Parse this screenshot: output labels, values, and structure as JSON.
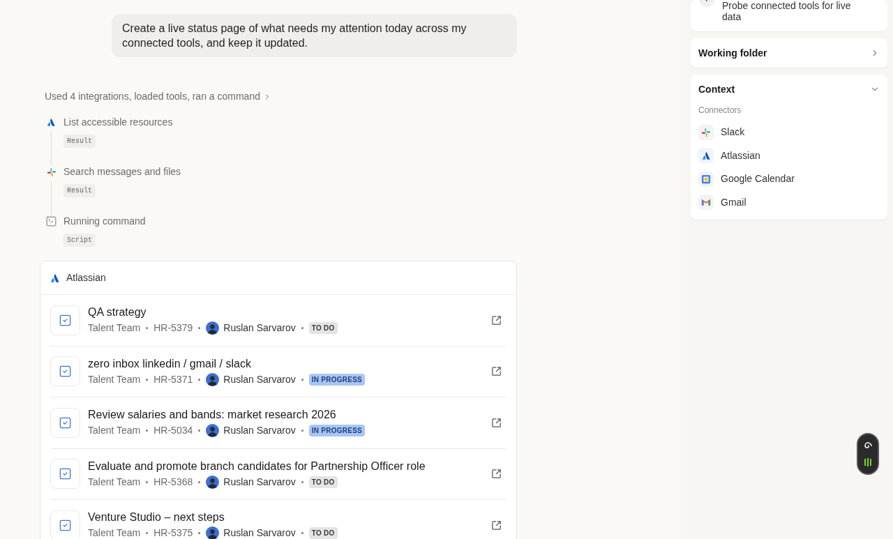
{
  "user_message": "Create a live status page of what needs my attention today across my connected tools, and keep it updated.",
  "activity": {
    "summary": "Used 4 integrations, loaded tools, ran a command",
    "expanded": false,
    "steps": [
      {
        "kind": "atlassian",
        "label": "List accessible resources",
        "tag": "Result"
      },
      {
        "kind": "slack",
        "label": "Search messages and files",
        "tag": "Result"
      },
      {
        "kind": "terminal",
        "label": "Running command",
        "tag": "Script"
      }
    ]
  },
  "card": {
    "title": "Atlassian",
    "issues": [
      {
        "title": "QA strategy",
        "team": "Talent Team",
        "key": "HR-5379",
        "assignee": "Ruslan Sarvarov",
        "status": "TO DO",
        "kind": "todo",
        "checked": true
      },
      {
        "title": "zero inbox linkedin / gmail / slack",
        "team": "Talent Team",
        "key": "HR-5371",
        "assignee": "Ruslan Sarvarov",
        "status": "IN PROGRESS",
        "kind": "progress",
        "checked": true
      },
      {
        "title": "Review salaries and bands: market research 2026",
        "team": "Talent Team",
        "key": "HR-5034",
        "assignee": "Ruslan Sarvarov",
        "status": "IN PROGRESS",
        "kind": "progress",
        "checked": true
      },
      {
        "title": "Evaluate and promote branch candidates for Partnership Officer role",
        "team": "Talent Team",
        "key": "HR-5368",
        "assignee": "Ruslan Sarvarov",
        "status": "TO DO",
        "kind": "todo",
        "checked": true
      },
      {
        "title": "Venture Studio – next steps",
        "team": "Talent Team",
        "key": "HR-5375",
        "assignee": "Ruslan Sarvarov",
        "status": "TO DO",
        "kind": "todo",
        "checked": true
      }
    ]
  },
  "sidebar": {
    "progress_step": "Probe connected tools for live data",
    "working_folder": {
      "title": "Working folder",
      "expanded": false
    },
    "context": {
      "title": "Context",
      "expanded": true,
      "section": "Connectors",
      "connectors": [
        {
          "kind": "slack",
          "name": "Slack"
        },
        {
          "kind": "atlassian",
          "name": "Atlassian"
        },
        {
          "kind": "calendar",
          "name": "Google Calendar"
        },
        {
          "kind": "gmail",
          "name": "Gmail"
        }
      ]
    }
  }
}
